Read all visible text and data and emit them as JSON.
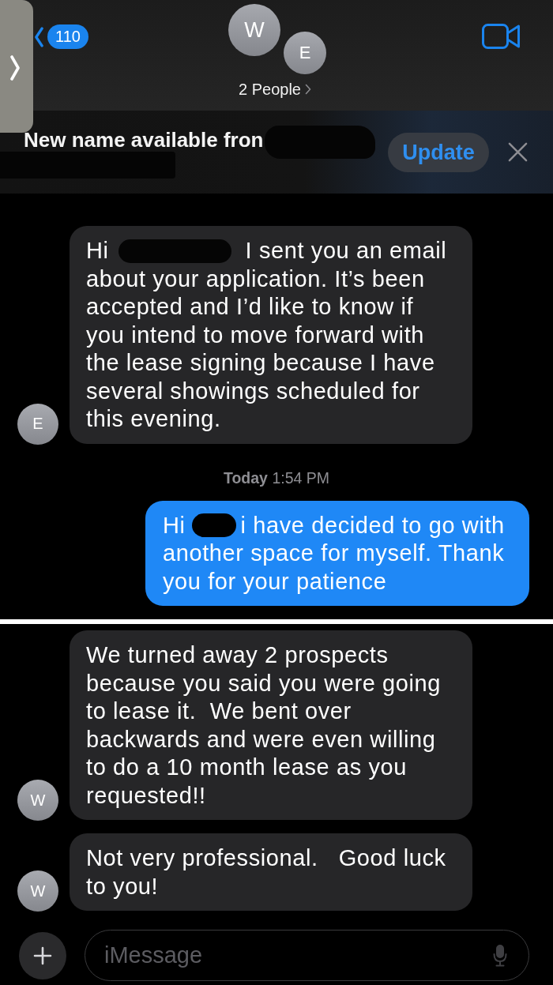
{
  "header": {
    "back_badge": "110",
    "avatars": [
      {
        "initial": "W"
      },
      {
        "initial": "E"
      }
    ],
    "group_label": "2 People"
  },
  "banner": {
    "lines": [
      {
        "parts": [
          {
            "kind": "text",
            "text": "New name available fron"
          },
          {
            "kind": "redaction"
          }
        ]
      },
      {
        "parts": [
          {
            "kind": "redaction"
          }
        ]
      }
    ],
    "button": "Update"
  },
  "messages": [
    {
      "kind": "received",
      "avatar": "E",
      "lead": [
        {
          "kind": "text",
          "text": "Hi"
        },
        {
          "kind": "redaction"
        },
        {
          "kind": "text",
          "text": "I sent you an email"
        }
      ],
      "body": "about your application. It’s been accepted and I’d like to know if you intend to move forward with the lease signing because I have several showings scheduled for this evening."
    },
    {
      "kind": "timestamp",
      "text": "**Today** 1:54 PM"
    },
    {
      "kind": "sent",
      "lead": [
        {
          "kind": "text",
          "text": "Hi"
        },
        {
          "kind": "redaction"
        },
        {
          "kind": "text",
          "text": "i have decided to go with"
        }
      ],
      "body": "another space for myself. Thank you for your patience"
    },
    {
      "kind": "divider"
    },
    {
      "kind": "received",
      "avatar": "W",
      "body": "We turned away 2 prospects because you said you were going to lease it.  We bent over backwards and were even willing to do a 10 month lease as you requested!!"
    },
    {
      "kind": "received",
      "avatar": "W",
      "body": "Not very professional.   Good luck to you!"
    }
  ],
  "composer": {
    "placeholder": "iMessage"
  }
}
